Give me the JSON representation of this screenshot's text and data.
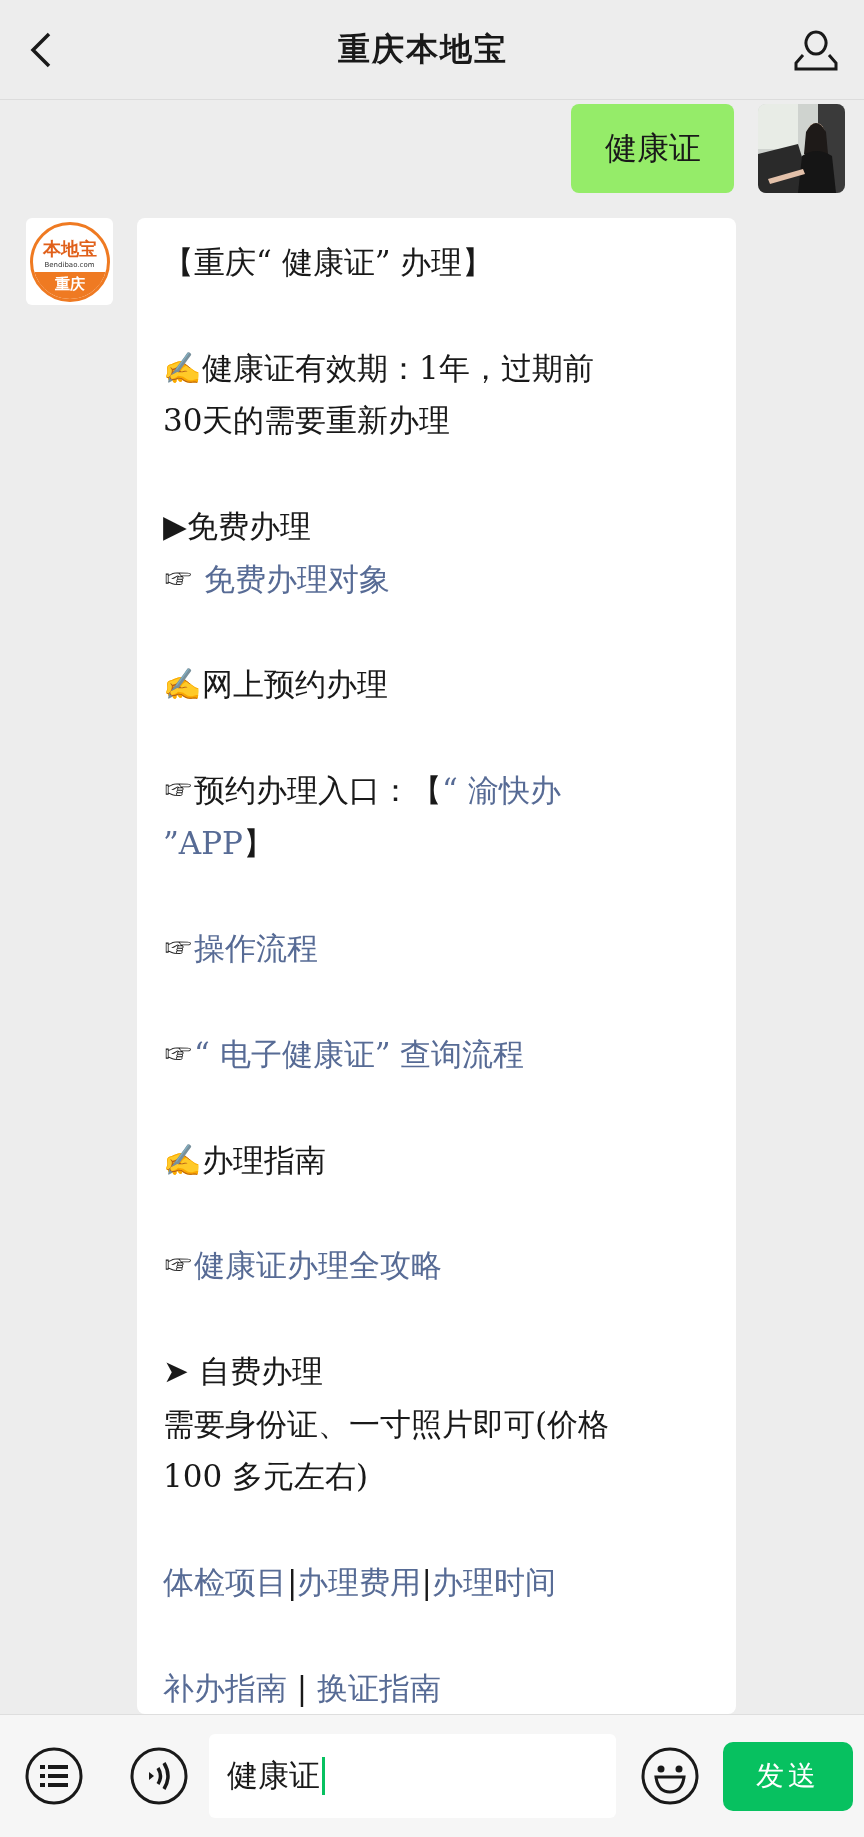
{
  "header": {
    "title": "重庆本地宝"
  },
  "outgoing": {
    "text": "健康证"
  },
  "incoming": {
    "avatar": {
      "brand": "本地宝",
      "site": "Bendibao.com",
      "city": "重庆"
    },
    "paragraphs": [
      [
        [
          {
            "kind": "plain",
            "text": "【重庆“ 健康证” 办理】"
          }
        ]
      ],
      [
        [
          {
            "kind": "plain",
            "text": "✍健康证有效期：1年，过期前"
          }
        ],
        [
          {
            "kind": "plain",
            "text": "30天的需要重新办理"
          }
        ]
      ],
      [
        [
          {
            "kind": "plain",
            "text": "▶免费办理"
          }
        ],
        [
          {
            "kind": "plain",
            "text": "☞ "
          },
          {
            "kind": "link",
            "text": "免费办理对象"
          }
        ]
      ],
      [
        [
          {
            "kind": "plain",
            "text": "✍网上预约办理"
          }
        ]
      ],
      [
        [
          {
            "kind": "plain",
            "text": "☞预约办理入口：【"
          },
          {
            "kind": "link",
            "text": "“ 渝快办"
          }
        ],
        [
          {
            "kind": "link",
            "text": "”APP"
          },
          {
            "kind": "plain",
            "text": "】"
          }
        ]
      ],
      [
        [
          {
            "kind": "plain",
            "text": "☞"
          },
          {
            "kind": "link",
            "text": "操作流程"
          }
        ]
      ],
      [
        [
          {
            "kind": "plain",
            "text": "☞"
          },
          {
            "kind": "link",
            "text": "“ 电子健康证” 查询流程"
          }
        ]
      ],
      [
        [
          {
            "kind": "plain",
            "text": "✍办理指南"
          }
        ]
      ],
      [
        [
          {
            "kind": "plain",
            "text": "☞"
          },
          {
            "kind": "link",
            "text": "健康证办理全攻略"
          }
        ]
      ],
      [
        [
          {
            "kind": "plain",
            "text": "➤ 自费办理"
          }
        ],
        [
          {
            "kind": "plain",
            "text": "需要身份证、一寸照片即可(价格"
          }
        ],
        [
          {
            "kind": "plain",
            "text": "100 多元左右)"
          }
        ]
      ],
      [
        [
          {
            "kind": "link",
            "text": "体检项目"
          },
          {
            "kind": "plain",
            "text": "|"
          },
          {
            "kind": "link",
            "text": "办理费用"
          },
          {
            "kind": "plain",
            "text": "|"
          },
          {
            "kind": "link",
            "text": "办理时间"
          }
        ]
      ],
      [
        [
          {
            "kind": "link",
            "text": "补办指南"
          },
          {
            "kind": "plain",
            "text": " | "
          },
          {
            "kind": "link",
            "text": "换证指南"
          }
        ]
      ]
    ]
  },
  "input_bar": {
    "value": "健康证",
    "send": "发送"
  }
}
